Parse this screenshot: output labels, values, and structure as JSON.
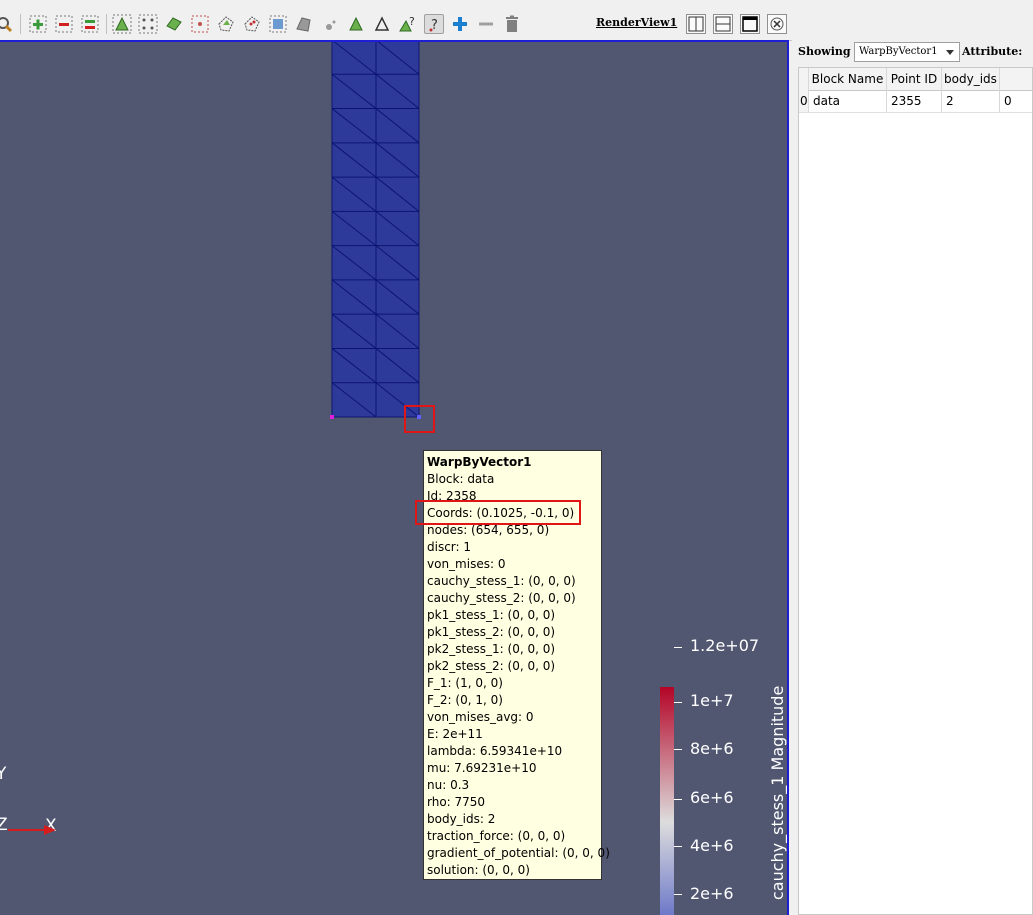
{
  "toolbar": {
    "render_view_label": "RenderView1"
  },
  "tooltip": {
    "title": "WarpByVector1",
    "lines": [
      "Block: data",
      "Id: 2358",
      "Coords: (0.1025, -0.1, 0)",
      "nodes: (654, 655, 0)",
      "discr: 1",
      "von_mises: 0",
      "cauchy_stess_1: (0, 0, 0)",
      "cauchy_stess_2: (0, 0, 0)",
      "pk1_stess_1: (0, 0, 0)",
      "pk1_stess_2: (0, 0, 0)",
      "pk2_stess_1: (0, 0, 0)",
      "pk2_stess_2: (0, 0, 0)",
      "F_1: (1, 0, 0)",
      "F_2: (0, 1, 0)",
      "von_mises_avg: 0",
      "E: 2e+11",
      "lambda: 6.59341e+10",
      "mu: 7.69231e+10",
      "nu: 0.3",
      "rho: 7750",
      "body_ids: 2",
      "traction_force: (0, 0, 0)",
      "gradient_of_potential: (0, 0, 0)",
      "solution: (0, 0, 0)"
    ]
  },
  "legend": {
    "title": "cauchy_stess_1 Magnitude",
    "ticks": [
      "1.2e+07",
      "1e+7",
      "8e+6",
      "6e+6",
      "4e+6",
      "2e+6"
    ],
    "colors": {
      "high": "#b40426",
      "mid": "#dddddd",
      "low": "#3b4cc0"
    }
  },
  "axes": {
    "y": "Y",
    "z": "Z",
    "x": "X"
  },
  "panel": {
    "showing_label": "Showing",
    "showing_value": "WarpByVector1",
    "attribute_label": "Attribute:",
    "columns": [
      "",
      "Block Name",
      "Point ID",
      "body_ids",
      ""
    ],
    "rows": [
      [
        "0",
        "data",
        "2355",
        "2",
        "0"
      ]
    ]
  },
  "colors": {
    "background": "#525771",
    "mesh_fill": "#2e3a9a",
    "mesh_edge": "#0c1470",
    "highlight": "#e01515",
    "view_border": "#1e1ed2"
  }
}
